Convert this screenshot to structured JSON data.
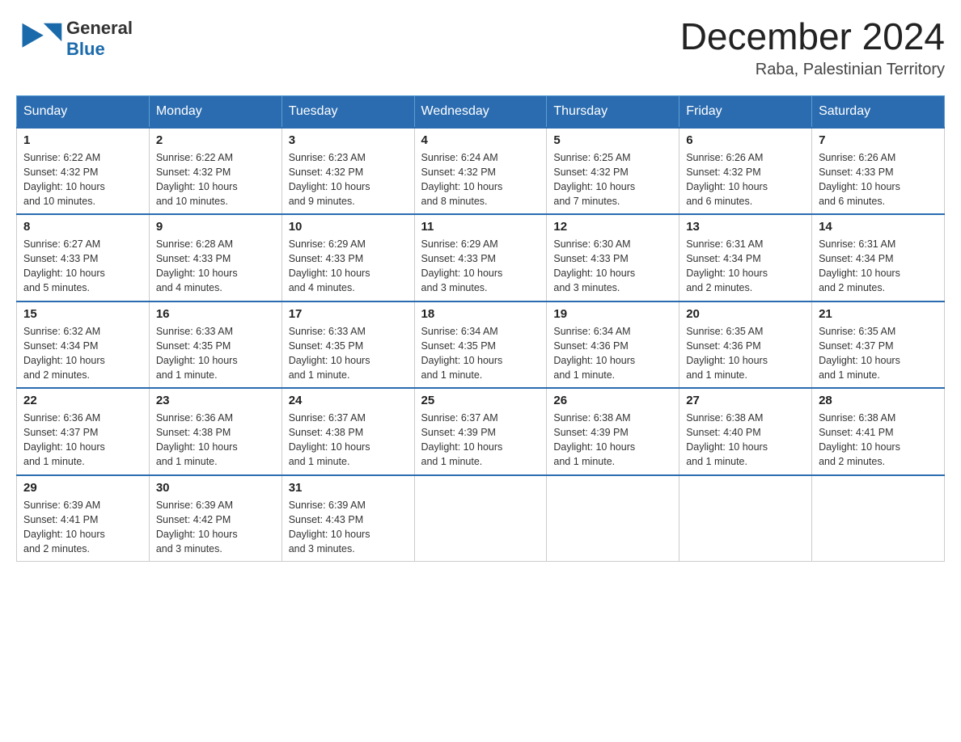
{
  "header": {
    "logo_general": "General",
    "logo_blue": "Blue",
    "month_title": "December 2024",
    "location": "Raba, Palestinian Territory"
  },
  "weekdays": [
    "Sunday",
    "Monday",
    "Tuesday",
    "Wednesday",
    "Thursday",
    "Friday",
    "Saturday"
  ],
  "rows": [
    [
      {
        "day": "1",
        "sunrise": "6:22 AM",
        "sunset": "4:32 PM",
        "daylight": "10 hours and 10 minutes."
      },
      {
        "day": "2",
        "sunrise": "6:22 AM",
        "sunset": "4:32 PM",
        "daylight": "10 hours and 10 minutes."
      },
      {
        "day": "3",
        "sunrise": "6:23 AM",
        "sunset": "4:32 PM",
        "daylight": "10 hours and 9 minutes."
      },
      {
        "day": "4",
        "sunrise": "6:24 AM",
        "sunset": "4:32 PM",
        "daylight": "10 hours and 8 minutes."
      },
      {
        "day": "5",
        "sunrise": "6:25 AM",
        "sunset": "4:32 PM",
        "daylight": "10 hours and 7 minutes."
      },
      {
        "day": "6",
        "sunrise": "6:26 AM",
        "sunset": "4:32 PM",
        "daylight": "10 hours and 6 minutes."
      },
      {
        "day": "7",
        "sunrise": "6:26 AM",
        "sunset": "4:33 PM",
        "daylight": "10 hours and 6 minutes."
      }
    ],
    [
      {
        "day": "8",
        "sunrise": "6:27 AM",
        "sunset": "4:33 PM",
        "daylight": "10 hours and 5 minutes."
      },
      {
        "day": "9",
        "sunrise": "6:28 AM",
        "sunset": "4:33 PM",
        "daylight": "10 hours and 4 minutes."
      },
      {
        "day": "10",
        "sunrise": "6:29 AM",
        "sunset": "4:33 PM",
        "daylight": "10 hours and 4 minutes."
      },
      {
        "day": "11",
        "sunrise": "6:29 AM",
        "sunset": "4:33 PM",
        "daylight": "10 hours and 3 minutes."
      },
      {
        "day": "12",
        "sunrise": "6:30 AM",
        "sunset": "4:33 PM",
        "daylight": "10 hours and 3 minutes."
      },
      {
        "day": "13",
        "sunrise": "6:31 AM",
        "sunset": "4:34 PM",
        "daylight": "10 hours and 2 minutes."
      },
      {
        "day": "14",
        "sunrise": "6:31 AM",
        "sunset": "4:34 PM",
        "daylight": "10 hours and 2 minutes."
      }
    ],
    [
      {
        "day": "15",
        "sunrise": "6:32 AM",
        "sunset": "4:34 PM",
        "daylight": "10 hours and 2 minutes."
      },
      {
        "day": "16",
        "sunrise": "6:33 AM",
        "sunset": "4:35 PM",
        "daylight": "10 hours and 1 minute."
      },
      {
        "day": "17",
        "sunrise": "6:33 AM",
        "sunset": "4:35 PM",
        "daylight": "10 hours and 1 minute."
      },
      {
        "day": "18",
        "sunrise": "6:34 AM",
        "sunset": "4:35 PM",
        "daylight": "10 hours and 1 minute."
      },
      {
        "day": "19",
        "sunrise": "6:34 AM",
        "sunset": "4:36 PM",
        "daylight": "10 hours and 1 minute."
      },
      {
        "day": "20",
        "sunrise": "6:35 AM",
        "sunset": "4:36 PM",
        "daylight": "10 hours and 1 minute."
      },
      {
        "day": "21",
        "sunrise": "6:35 AM",
        "sunset": "4:37 PM",
        "daylight": "10 hours and 1 minute."
      }
    ],
    [
      {
        "day": "22",
        "sunrise": "6:36 AM",
        "sunset": "4:37 PM",
        "daylight": "10 hours and 1 minute."
      },
      {
        "day": "23",
        "sunrise": "6:36 AM",
        "sunset": "4:38 PM",
        "daylight": "10 hours and 1 minute."
      },
      {
        "day": "24",
        "sunrise": "6:37 AM",
        "sunset": "4:38 PM",
        "daylight": "10 hours and 1 minute."
      },
      {
        "day": "25",
        "sunrise": "6:37 AM",
        "sunset": "4:39 PM",
        "daylight": "10 hours and 1 minute."
      },
      {
        "day": "26",
        "sunrise": "6:38 AM",
        "sunset": "4:39 PM",
        "daylight": "10 hours and 1 minute."
      },
      {
        "day": "27",
        "sunrise": "6:38 AM",
        "sunset": "4:40 PM",
        "daylight": "10 hours and 1 minute."
      },
      {
        "day": "28",
        "sunrise": "6:38 AM",
        "sunset": "4:41 PM",
        "daylight": "10 hours and 2 minutes."
      }
    ],
    [
      {
        "day": "29",
        "sunrise": "6:39 AM",
        "sunset": "4:41 PM",
        "daylight": "10 hours and 2 minutes."
      },
      {
        "day": "30",
        "sunrise": "6:39 AM",
        "sunset": "4:42 PM",
        "daylight": "10 hours and 3 minutes."
      },
      {
        "day": "31",
        "sunrise": "6:39 AM",
        "sunset": "4:43 PM",
        "daylight": "10 hours and 3 minutes."
      },
      null,
      null,
      null,
      null
    ]
  ],
  "labels": {
    "sunrise": "Sunrise:",
    "sunset": "Sunset:",
    "daylight": "Daylight:"
  }
}
